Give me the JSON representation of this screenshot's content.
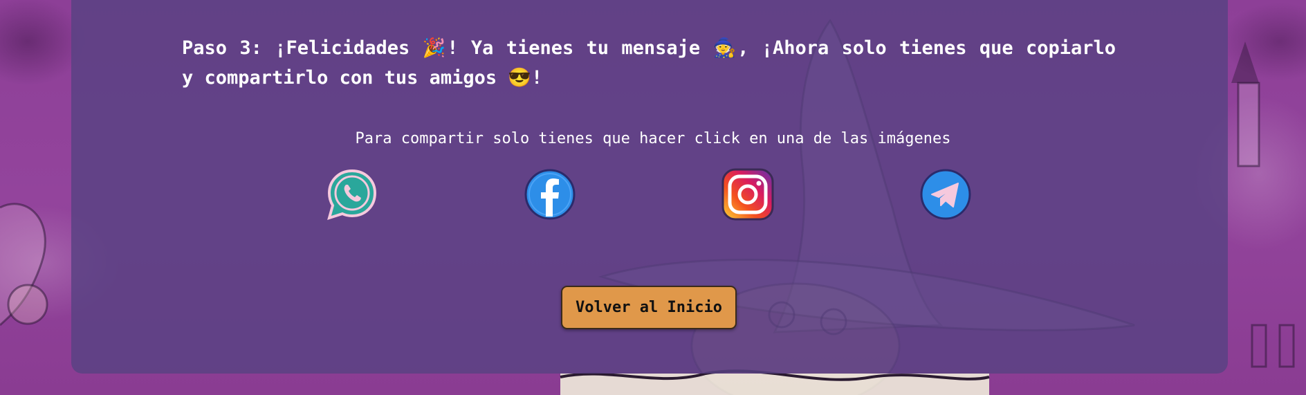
{
  "main": {
    "title": "Paso 3: ¡Felicidades 🎉! Ya tienes tu mensaje 🧙, ¡Ahora solo tienes que copiarlo y compartirlo con tus amigos 😎!",
    "share_instructions": "Para compartir solo tienes que hacer click en una de las imágenes",
    "share_options": [
      {
        "icon": "whatsapp-icon"
      },
      {
        "icon": "facebook-icon"
      },
      {
        "icon": "instagram-icon"
      },
      {
        "icon": "telegram-icon"
      }
    ],
    "home_button_label": "Volver al Inicio"
  },
  "colors": {
    "page_background": "#8a3f93",
    "card_overlay": "#584282",
    "button_background": "#e0984a",
    "text": "#ffffff"
  }
}
